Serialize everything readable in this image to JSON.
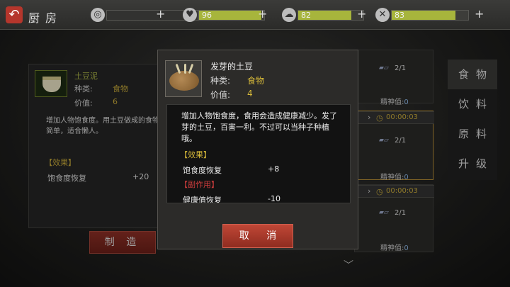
{
  "header": {
    "title": "厨房",
    "stats": [
      {
        "name": "money",
        "icon": "coin-icon",
        "value": "0",
        "fill": 0
      },
      {
        "name": "health",
        "icon": "heart-icon",
        "value": "96",
        "fill": 0.96
      },
      {
        "name": "mind",
        "icon": "brain-icon",
        "value": "82",
        "fill": 0.82
      },
      {
        "name": "hunger",
        "icon": "utensils-icon",
        "value": "83",
        "fill": 0.83
      }
    ],
    "plus": "+"
  },
  "left_panel": {
    "name": "土豆泥",
    "kind_label": "种类:",
    "kind": "食物",
    "value_label": "价值:",
    "value": "6",
    "description": "增加人物饱食度。用土豆做成的食物，方法简单，适合懒人。",
    "effect_header": "【效果】",
    "effect_name": "饱食度恢复",
    "effect_value": "+20",
    "make_button": "制 造"
  },
  "list": {
    "counts": [
      "2/1",
      "2/1",
      "2/1"
    ],
    "spirit_label": "精神值:",
    "spirit_value": "0",
    "timer": "00:00:03"
  },
  "categories": [
    "食物",
    "饮料",
    "原料",
    "升级"
  ],
  "popup": {
    "name": "发芽的土豆",
    "kind_label": "种类:",
    "kind": "食物",
    "value_label": "价值:",
    "value": "4",
    "description": "增加人物饱食度，食用会造成健康减少。发了芽的土豆，百害一利。不过可以当种子种植哦。",
    "effect_header": "【效果】",
    "effect_name": "饱食度恢复",
    "effect_value": "+8",
    "side_header": "【副作用】",
    "side_name": "健康值恢复",
    "side_value": "-10",
    "cancel_button": "取 消"
  }
}
